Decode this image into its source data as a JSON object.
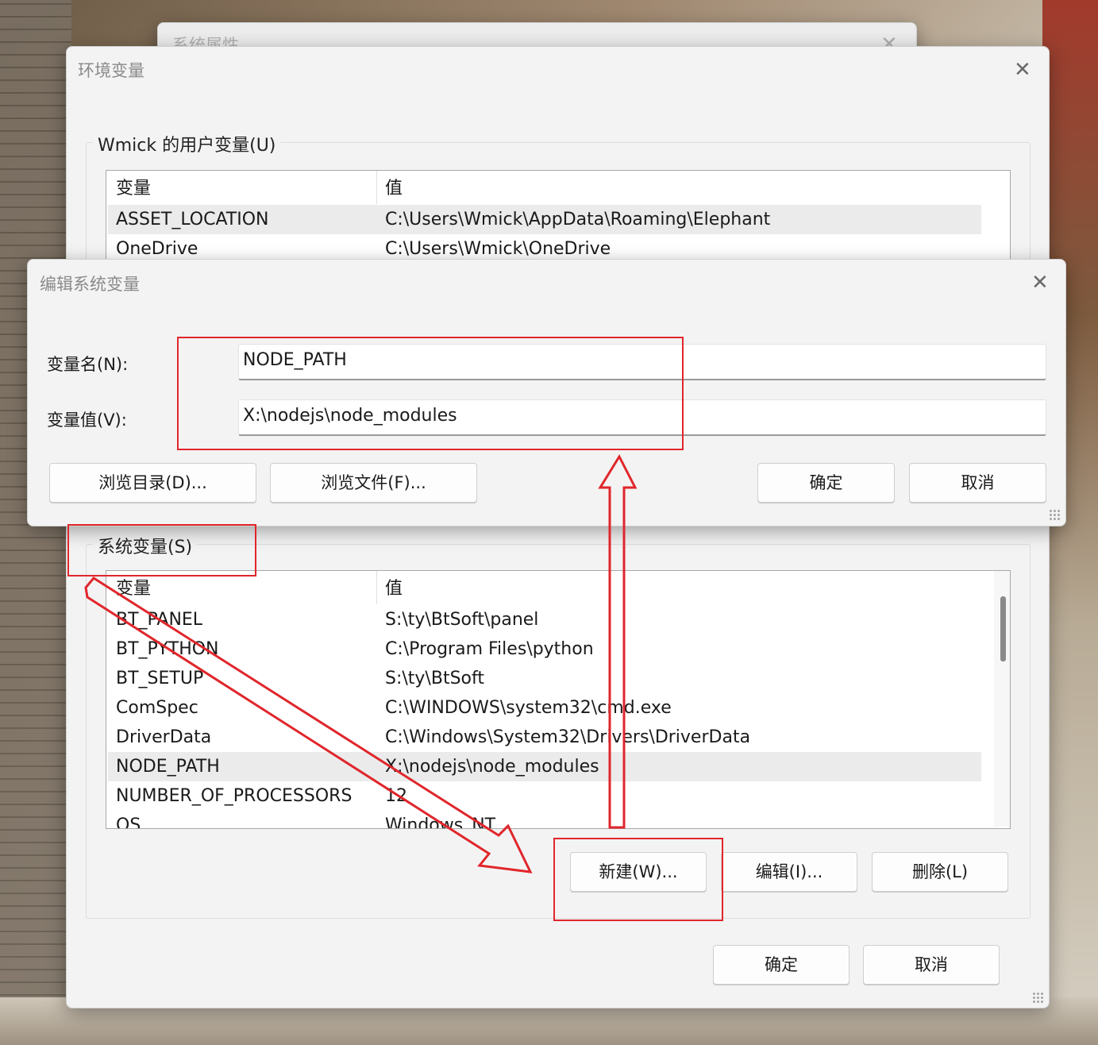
{
  "system_properties": {
    "title": "系统属性",
    "close_icon": "✕"
  },
  "env_dialog": {
    "title": "环境变量",
    "close_icon": "✕",
    "user_section": {
      "label": "Wmick 的用户变量(U)",
      "columns": [
        "变量",
        "值"
      ],
      "rows": [
        {
          "name": "ASSET_LOCATION",
          "value": "C:\\Users\\Wmick\\AppData\\Roaming\\Elephant"
        },
        {
          "name": "OneDrive",
          "value": "C:\\Users\\Wmick\\OneDrive"
        }
      ]
    },
    "system_section": {
      "label": "系统变量(S)",
      "columns": [
        "变量",
        "值"
      ],
      "rows": [
        {
          "name": "BT_PANEL",
          "value": "S:\\ty\\BtSoft\\panel"
        },
        {
          "name": "BT_PYTHON",
          "value": "C:\\Program Files\\python"
        },
        {
          "name": "BT_SETUP",
          "value": "S:\\ty\\BtSoft"
        },
        {
          "name": "ComSpec",
          "value": "C:\\WINDOWS\\system32\\cmd.exe"
        },
        {
          "name": "DriverData",
          "value": "C:\\Windows\\System32\\Drivers\\DriverData"
        },
        {
          "name": "NODE_PATH",
          "value": "X:\\nodejs\\node_modules"
        },
        {
          "name": "NUMBER_OF_PROCESSORS",
          "value": "12"
        },
        {
          "name": "OS",
          "value": "Windows_NT"
        }
      ],
      "buttons": {
        "new": "新建(W)...",
        "edit": "编辑(I)...",
        "delete": "删除(L)"
      }
    },
    "ok": "确定",
    "cancel": "取消"
  },
  "edit_dialog": {
    "title": "编辑系统变量",
    "close_icon": "✕",
    "name_label": "变量名(N):",
    "value_label": "变量值(V):",
    "name_value": "NODE_PATH",
    "value_value": "X:\\nodejs\\node_modules",
    "browse_dir": "浏览目录(D)...",
    "browse_file": "浏览文件(F)...",
    "ok": "确定",
    "cancel": "取消"
  },
  "annotation_color": "#e0262b"
}
